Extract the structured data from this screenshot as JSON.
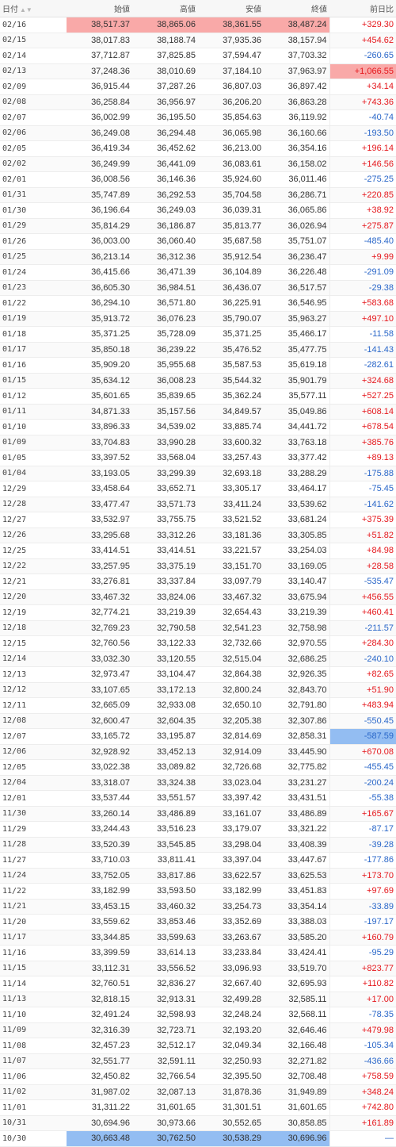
{
  "colors": {
    "up": "#e5171c",
    "down": "#2a67c9",
    "highlight_max": "#f9a9a8",
    "highlight_min": "#93bdf2"
  },
  "header": {
    "date": "日付",
    "sort_icon": "▲▼",
    "open": "始値",
    "high": "高値",
    "low": "安値",
    "close": "終値",
    "change": "前日比"
  },
  "rows": [
    {
      "date": "02/16",
      "open": "38,517.37",
      "high": "38,865.06",
      "low": "38,361.55",
      "close": "38,487.24",
      "change": "+329.30",
      "dir": "up",
      "hl": [
        "open",
        "high",
        "low",
        "close"
      ]
    },
    {
      "date": "02/15",
      "open": "38,017.83",
      "high": "38,188.74",
      "low": "37,935.36",
      "close": "38,157.94",
      "change": "+454.62",
      "dir": "up"
    },
    {
      "date": "02/14",
      "open": "37,712.87",
      "high": "37,825.85",
      "low": "37,594.47",
      "close": "37,703.32",
      "change": "-260.65",
      "dir": "down"
    },
    {
      "date": "02/13",
      "open": "37,248.36",
      "high": "38,010.69",
      "low": "37,184.10",
      "close": "37,963.97",
      "change": "+1,066.55",
      "dir": "up",
      "hl": [
        "change"
      ]
    },
    {
      "date": "02/09",
      "open": "36,915.44",
      "high": "37,287.26",
      "low": "36,807.03",
      "close": "36,897.42",
      "change": "+34.14",
      "dir": "up"
    },
    {
      "date": "02/08",
      "open": "36,258.84",
      "high": "36,956.97",
      "low": "36,206.20",
      "close": "36,863.28",
      "change": "+743.36",
      "dir": "up"
    },
    {
      "date": "02/07",
      "open": "36,002.99",
      "high": "36,195.50",
      "low": "35,854.63",
      "close": "36,119.92",
      "change": "-40.74",
      "dir": "down"
    },
    {
      "date": "02/06",
      "open": "36,249.08",
      "high": "36,294.48",
      "low": "36,065.98",
      "close": "36,160.66",
      "change": "-193.50",
      "dir": "down"
    },
    {
      "date": "02/05",
      "open": "36,419.34",
      "high": "36,452.62",
      "low": "36,213.00",
      "close": "36,354.16",
      "change": "+196.14",
      "dir": "up"
    },
    {
      "date": "02/02",
      "open": "36,249.99",
      "high": "36,441.09",
      "low": "36,083.61",
      "close": "36,158.02",
      "change": "+146.56",
      "dir": "up"
    },
    {
      "date": "02/01",
      "open": "36,008.56",
      "high": "36,146.36",
      "low": "35,924.60",
      "close": "36,011.46",
      "change": "-275.25",
      "dir": "down"
    },
    {
      "date": "01/31",
      "open": "35,747.89",
      "high": "36,292.53",
      "low": "35,704.58",
      "close": "36,286.71",
      "change": "+220.85",
      "dir": "up"
    },
    {
      "date": "01/30",
      "open": "36,196.64",
      "high": "36,249.03",
      "low": "36,039.31",
      "close": "36,065.86",
      "change": "+38.92",
      "dir": "up"
    },
    {
      "date": "01/29",
      "open": "35,814.29",
      "high": "36,186.87",
      "low": "35,813.77",
      "close": "36,026.94",
      "change": "+275.87",
      "dir": "up"
    },
    {
      "date": "01/26",
      "open": "36,003.00",
      "high": "36,060.40",
      "low": "35,687.58",
      "close": "35,751.07",
      "change": "-485.40",
      "dir": "down"
    },
    {
      "date": "01/25",
      "open": "36,213.14",
      "high": "36,312.36",
      "low": "35,912.54",
      "close": "36,236.47",
      "change": "+9.99",
      "dir": "up"
    },
    {
      "date": "01/24",
      "open": "36,415.66",
      "high": "36,471.39",
      "low": "36,104.89",
      "close": "36,226.48",
      "change": "-291.09",
      "dir": "down"
    },
    {
      "date": "01/23",
      "open": "36,605.30",
      "high": "36,984.51",
      "low": "36,436.07",
      "close": "36,517.57",
      "change": "-29.38",
      "dir": "down"
    },
    {
      "date": "01/22",
      "open": "36,294.10",
      "high": "36,571.80",
      "low": "36,225.91",
      "close": "36,546.95",
      "change": "+583.68",
      "dir": "up"
    },
    {
      "date": "01/19",
      "open": "35,913.72",
      "high": "36,076.23",
      "low": "35,790.07",
      "close": "35,963.27",
      "change": "+497.10",
      "dir": "up"
    },
    {
      "date": "01/18",
      "open": "35,371.25",
      "high": "35,728.09",
      "low": "35,371.25",
      "close": "35,466.17",
      "change": "-11.58",
      "dir": "down"
    },
    {
      "date": "01/17",
      "open": "35,850.18",
      "high": "36,239.22",
      "low": "35,476.52",
      "close": "35,477.75",
      "change": "-141.43",
      "dir": "down"
    },
    {
      "date": "01/16",
      "open": "35,909.20",
      "high": "35,955.68",
      "low": "35,587.53",
      "close": "35,619.18",
      "change": "-282.61",
      "dir": "down"
    },
    {
      "date": "01/15",
      "open": "35,634.12",
      "high": "36,008.23",
      "low": "35,544.32",
      "close": "35,901.79",
      "change": "+324.68",
      "dir": "up"
    },
    {
      "date": "01/12",
      "open": "35,601.65",
      "high": "35,839.65",
      "low": "35,362.24",
      "close": "35,577.11",
      "change": "+527.25",
      "dir": "up"
    },
    {
      "date": "01/11",
      "open": "34,871.33",
      "high": "35,157.56",
      "low": "34,849.57",
      "close": "35,049.86",
      "change": "+608.14",
      "dir": "up"
    },
    {
      "date": "01/10",
      "open": "33,896.33",
      "high": "34,539.02",
      "low": "33,885.74",
      "close": "34,441.72",
      "change": "+678.54",
      "dir": "up"
    },
    {
      "date": "01/09",
      "open": "33,704.83",
      "high": "33,990.28",
      "low": "33,600.32",
      "close": "33,763.18",
      "change": "+385.76",
      "dir": "up"
    },
    {
      "date": "01/05",
      "open": "33,397.52",
      "high": "33,568.04",
      "low": "33,257.43",
      "close": "33,377.42",
      "change": "+89.13",
      "dir": "up"
    },
    {
      "date": "01/04",
      "open": "33,193.05",
      "high": "33,299.39",
      "low": "32,693.18",
      "close": "33,288.29",
      "change": "-175.88",
      "dir": "down"
    },
    {
      "date": "12/29",
      "open": "33,458.64",
      "high": "33,652.71",
      "low": "33,305.17",
      "close": "33,464.17",
      "change": "-75.45",
      "dir": "down"
    },
    {
      "date": "12/28",
      "open": "33,477.47",
      "high": "33,571.73",
      "low": "33,411.24",
      "close": "33,539.62",
      "change": "-141.62",
      "dir": "down"
    },
    {
      "date": "12/27",
      "open": "33,532.97",
      "high": "33,755.75",
      "low": "33,521.52",
      "close": "33,681.24",
      "change": "+375.39",
      "dir": "up"
    },
    {
      "date": "12/26",
      "open": "33,295.68",
      "high": "33,312.26",
      "low": "33,181.36",
      "close": "33,305.85",
      "change": "+51.82",
      "dir": "up"
    },
    {
      "date": "12/25",
      "open": "33,414.51",
      "high": "33,414.51",
      "low": "33,221.57",
      "close": "33,254.03",
      "change": "+84.98",
      "dir": "up"
    },
    {
      "date": "12/22",
      "open": "33,257.95",
      "high": "33,375.19",
      "low": "33,151.70",
      "close": "33,169.05",
      "change": "+28.58",
      "dir": "up"
    },
    {
      "date": "12/21",
      "open": "33,276.81",
      "high": "33,337.84",
      "low": "33,097.79",
      "close": "33,140.47",
      "change": "-535.47",
      "dir": "down"
    },
    {
      "date": "12/20",
      "open": "33,467.32",
      "high": "33,824.06",
      "low": "33,467.32",
      "close": "33,675.94",
      "change": "+456.55",
      "dir": "up"
    },
    {
      "date": "12/19",
      "open": "32,774.21",
      "high": "33,219.39",
      "low": "32,654.43",
      "close": "33,219.39",
      "change": "+460.41",
      "dir": "up"
    },
    {
      "date": "12/18",
      "open": "32,769.23",
      "high": "32,790.58",
      "low": "32,541.23",
      "close": "32,758.98",
      "change": "-211.57",
      "dir": "down"
    },
    {
      "date": "12/15",
      "open": "32,760.56",
      "high": "33,122.33",
      "low": "32,732.66",
      "close": "32,970.55",
      "change": "+284.30",
      "dir": "up"
    },
    {
      "date": "12/14",
      "open": "33,032.30",
      "high": "33,120.55",
      "low": "32,515.04",
      "close": "32,686.25",
      "change": "-240.10",
      "dir": "down"
    },
    {
      "date": "12/13",
      "open": "32,973.47",
      "high": "33,104.47",
      "low": "32,864.38",
      "close": "32,926.35",
      "change": "+82.65",
      "dir": "up"
    },
    {
      "date": "12/12",
      "open": "33,107.65",
      "high": "33,172.13",
      "low": "32,800.24",
      "close": "32,843.70",
      "change": "+51.90",
      "dir": "up"
    },
    {
      "date": "12/11",
      "open": "32,665.09",
      "high": "32,933.08",
      "low": "32,650.10",
      "close": "32,791.80",
      "change": "+483.94",
      "dir": "up"
    },
    {
      "date": "12/08",
      "open": "32,600.47",
      "high": "32,604.35",
      "low": "32,205.38",
      "close": "32,307.86",
      "change": "-550.45",
      "dir": "down"
    },
    {
      "date": "12/07",
      "open": "33,165.72",
      "high": "33,195.87",
      "low": "32,814.69",
      "close": "32,858.31",
      "change": "-587.59",
      "dir": "down",
      "hl_min": [
        "change"
      ]
    },
    {
      "date": "12/06",
      "open": "32,928.92",
      "high": "33,452.13",
      "low": "32,914.09",
      "close": "33,445.90",
      "change": "+670.08",
      "dir": "up"
    },
    {
      "date": "12/05",
      "open": "33,022.38",
      "high": "33,089.82",
      "low": "32,726.68",
      "close": "32,775.82",
      "change": "-455.45",
      "dir": "down"
    },
    {
      "date": "12/04",
      "open": "33,318.07",
      "high": "33,324.38",
      "low": "33,023.04",
      "close": "33,231.27",
      "change": "-200.24",
      "dir": "down"
    },
    {
      "date": "12/01",
      "open": "33,537.44",
      "high": "33,551.57",
      "low": "33,397.42",
      "close": "33,431.51",
      "change": "-55.38",
      "dir": "down"
    },
    {
      "date": "11/30",
      "open": "33,260.14",
      "high": "33,486.89",
      "low": "33,161.07",
      "close": "33,486.89",
      "change": "+165.67",
      "dir": "up"
    },
    {
      "date": "11/29",
      "open": "33,244.43",
      "high": "33,516.23",
      "low": "33,179.07",
      "close": "33,321.22",
      "change": "-87.17",
      "dir": "down"
    },
    {
      "date": "11/28",
      "open": "33,520.39",
      "high": "33,545.85",
      "low": "33,298.04",
      "close": "33,408.39",
      "change": "-39.28",
      "dir": "down"
    },
    {
      "date": "11/27",
      "open": "33,710.03",
      "high": "33,811.41",
      "low": "33,397.04",
      "close": "33,447.67",
      "change": "-177.86",
      "dir": "down"
    },
    {
      "date": "11/24",
      "open": "33,752.05",
      "high": "33,817.86",
      "low": "33,622.57",
      "close": "33,625.53",
      "change": "+173.70",
      "dir": "up"
    },
    {
      "date": "11/22",
      "open": "33,182.99",
      "high": "33,593.50",
      "low": "33,182.99",
      "close": "33,451.83",
      "change": "+97.69",
      "dir": "up"
    },
    {
      "date": "11/21",
      "open": "33,453.15",
      "high": "33,460.32",
      "low": "33,254.73",
      "close": "33,354.14",
      "change": "-33.89",
      "dir": "down"
    },
    {
      "date": "11/20",
      "open": "33,559.62",
      "high": "33,853.46",
      "low": "33,352.69",
      "close": "33,388.03",
      "change": "-197.17",
      "dir": "down"
    },
    {
      "date": "11/17",
      "open": "33,344.85",
      "high": "33,599.63",
      "low": "33,263.67",
      "close": "33,585.20",
      "change": "+160.79",
      "dir": "up"
    },
    {
      "date": "11/16",
      "open": "33,399.59",
      "high": "33,614.13",
      "low": "33,233.84",
      "close": "33,424.41",
      "change": "-95.29",
      "dir": "down"
    },
    {
      "date": "11/15",
      "open": "33,112.31",
      "high": "33,556.52",
      "low": "33,096.93",
      "close": "33,519.70",
      "change": "+823.77",
      "dir": "up"
    },
    {
      "date": "11/14",
      "open": "32,760.51",
      "high": "32,836.27",
      "low": "32,667.40",
      "close": "32,695.93",
      "change": "+110.82",
      "dir": "up"
    },
    {
      "date": "11/13",
      "open": "32,818.15",
      "high": "32,913.31",
      "low": "32,499.28",
      "close": "32,585.11",
      "change": "+17.00",
      "dir": "up"
    },
    {
      "date": "11/10",
      "open": "32,491.24",
      "high": "32,598.93",
      "low": "32,248.24",
      "close": "32,568.11",
      "change": "-78.35",
      "dir": "down"
    },
    {
      "date": "11/09",
      "open": "32,316.39",
      "high": "32,723.71",
      "low": "32,193.20",
      "close": "32,646.46",
      "change": "+479.98",
      "dir": "up"
    },
    {
      "date": "11/08",
      "open": "32,457.23",
      "high": "32,512.17",
      "low": "32,049.34",
      "close": "32,166.48",
      "change": "-105.34",
      "dir": "down"
    },
    {
      "date": "11/07",
      "open": "32,551.77",
      "high": "32,591.11",
      "low": "32,250.93",
      "close": "32,271.82",
      "change": "-436.66",
      "dir": "down"
    },
    {
      "date": "11/06",
      "open": "32,450.82",
      "high": "32,766.54",
      "low": "32,395.50",
      "close": "32,708.48",
      "change": "+758.59",
      "dir": "up"
    },
    {
      "date": "11/02",
      "open": "31,987.02",
      "high": "32,087.13",
      "low": "31,878.36",
      "close": "31,949.89",
      "change": "+348.24",
      "dir": "up"
    },
    {
      "date": "11/01",
      "open": "31,311.22",
      "high": "31,601.65",
      "low": "31,301.51",
      "close": "31,601.65",
      "change": "+742.80",
      "dir": "up"
    },
    {
      "date": "10/31",
      "open": "30,694.96",
      "high": "30,973.66",
      "low": "30,552.65",
      "close": "30,858.85",
      "change": "+161.89",
      "dir": "up"
    },
    {
      "date": "10/30",
      "open": "30,663.48",
      "high": "30,762.50",
      "low": "30,538.29",
      "close": "30,696.96",
      "change": "—",
      "dir": "flat",
      "hl_min": [
        "open",
        "high",
        "low",
        "close"
      ]
    }
  ]
}
